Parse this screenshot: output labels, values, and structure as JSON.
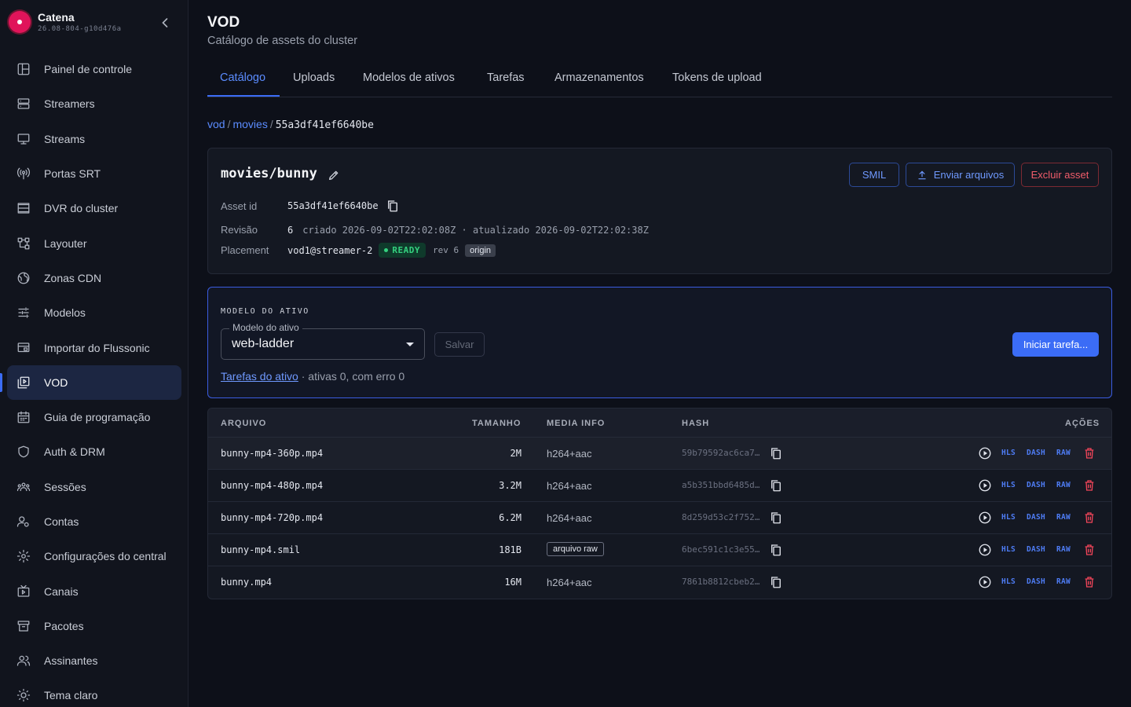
{
  "brand": {
    "name": "Catena",
    "version": "26.08-804-g10d476a"
  },
  "sidebar": {
    "items": [
      {
        "label": "Painel de controle",
        "icon": "dashboard-icon"
      },
      {
        "label": "Streamers",
        "icon": "server-icon"
      },
      {
        "label": "Streams",
        "icon": "monitor-icon"
      },
      {
        "label": "Portas SRT",
        "icon": "antenna-icon"
      },
      {
        "label": "DVR do cluster",
        "icon": "storage-icon"
      },
      {
        "label": "Layouter",
        "icon": "layout-icon"
      },
      {
        "label": "Zonas CDN",
        "icon": "globe-icon"
      },
      {
        "label": "Modelos",
        "icon": "sliders-icon"
      },
      {
        "label": "Importar do Flussonic",
        "icon": "import-icon"
      },
      {
        "label": "VOD",
        "icon": "video-library-icon",
        "active": true
      },
      {
        "label": "Guia de programação",
        "icon": "calendar-icon"
      },
      {
        "label": "Auth & DRM",
        "icon": "shield-icon"
      },
      {
        "label": "Sessões",
        "icon": "group-icon"
      },
      {
        "label": "Contas",
        "icon": "user-settings-icon"
      },
      {
        "label": "Configurações do central",
        "icon": "gear-icon"
      },
      {
        "label": "Canais",
        "icon": "tv-icon"
      },
      {
        "label": "Pacotes",
        "icon": "archive-icon"
      },
      {
        "label": "Assinantes",
        "icon": "users-icon"
      },
      {
        "label": "Tema claro",
        "icon": "sun-icon"
      }
    ]
  },
  "header": {
    "title": "VOD",
    "subtitle": "Catálogo de assets do cluster"
  },
  "tabs": [
    {
      "label": "Catálogo",
      "active": true
    },
    {
      "label": "Uploads"
    },
    {
      "label": "Modelos de ativos"
    },
    {
      "label": "Tarefas"
    },
    {
      "label": "Armazenamentos"
    },
    {
      "label": "Tokens de upload"
    }
  ],
  "breadcrumb": {
    "root": "vod",
    "folder": "movies",
    "current": "55a3df41ef6640be"
  },
  "asset": {
    "title": "movies/bunny",
    "buttons": {
      "smil": "SMIL",
      "upload": "Enviar arquivos",
      "delete": "Excluir asset"
    },
    "id_label": "Asset id",
    "id_value": "55a3df41ef6640be",
    "rev_label": "Revisão",
    "rev_value": "6",
    "rev_detail": "criado 2026-09-02T22:02:08Z · atualizado 2026-09-02T22:02:38Z",
    "placement_label": "Placement",
    "placement_value": "vod1@streamer-2",
    "placement_status": "READY",
    "placement_rev": "rev 6",
    "placement_tag": "origin",
    "status_color": "#34d17f"
  },
  "model": {
    "section_label": "MODELO DO ATIVO",
    "select_label": "Modelo do ativo",
    "select_value": "web-ladder",
    "save_label": "Salvar",
    "start_label": "Iniciar tarefa...",
    "tasks_link": "Tarefas do ativo",
    "tasks_summary": " · ativas 0, com erro 0"
  },
  "table": {
    "headers": {
      "file": "ARQUIVO",
      "size": "TAMANHO",
      "media": "MEDIA INFO",
      "hash": "HASH",
      "actions": "AÇÕES"
    },
    "action_labels": {
      "hls": "HLS",
      "dash": "DASH",
      "raw": "RAW"
    },
    "rows": [
      {
        "name": "bunny-mp4-360p.mp4",
        "size": "2M",
        "media": "h264+aac",
        "hash": "59b79592ac6ca7…"
      },
      {
        "name": "bunny-mp4-480p.mp4",
        "size": "3.2M",
        "media": "h264+aac",
        "hash": "a5b351bbd6485d…"
      },
      {
        "name": "bunny-mp4-720p.mp4",
        "size": "6.2M",
        "media": "h264+aac",
        "hash": "8d259d53c2f752…"
      },
      {
        "name": "bunny-mp4.smil",
        "size": "181B",
        "media_tag": "arquivo raw",
        "hash": "6bec591c1c3e55…"
      },
      {
        "name": "bunny.mp4",
        "size": "16M",
        "media": "h264+aac",
        "hash": "7861b8812cbeb2…"
      }
    ]
  },
  "colors": {
    "accent": "#3b6cf6",
    "danger": "#f25d6b",
    "ready": "#34d17f",
    "brand": "#e0145a"
  }
}
